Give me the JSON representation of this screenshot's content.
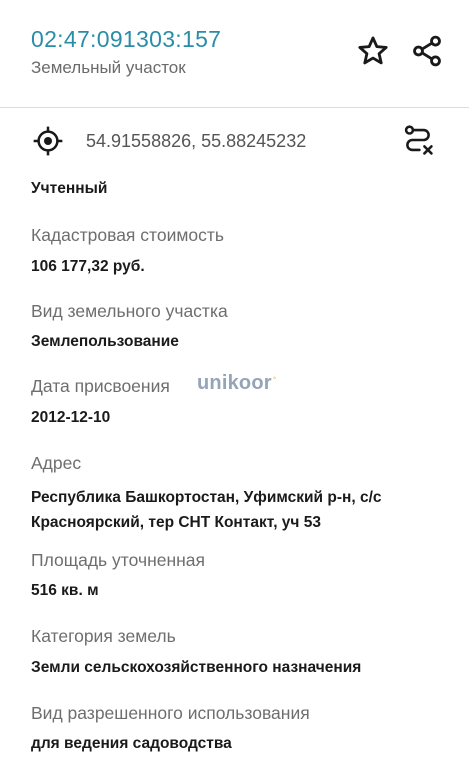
{
  "header": {
    "cadastral_number": "02:47:091303:157",
    "object_type": "Земельный участок",
    "star_icon": "star-outline-icon",
    "share_icon": "share-icon"
  },
  "coords": {
    "text": "54.91558826, 55.88245232",
    "target_icon": "crosshair-target-icon",
    "route_icon": "route-clear-icon"
  },
  "details": {
    "status": "Учтенный",
    "cost_label": "Кадастровая стоимость",
    "cost_value": "106 177,32 руб.",
    "kind_label": "Вид земельного участка",
    "kind_value": "Землепользование",
    "date_label": "Дата присвоения",
    "date_value": "2012-12-10",
    "address_label": "Адрес",
    "address_value": "Республика Башкортостан, Уфимский р-н, с/с Красноярский, тер СНТ Контакт, уч 53",
    "area_label": "Площадь уточненная",
    "area_value": "516 кв. м",
    "category_label": "Категория земель",
    "category_value": "Земли сельскохозяйственного назначения",
    "use_label": "Вид разрешенного использования",
    "use_value": "для ведения садоводства"
  },
  "watermark": {
    "text": "unikoor"
  },
  "colors": {
    "accent": "#2a8da6",
    "label": "#6e6e6e",
    "value": "#1a1a1a",
    "divider": "#dcdcdc"
  }
}
